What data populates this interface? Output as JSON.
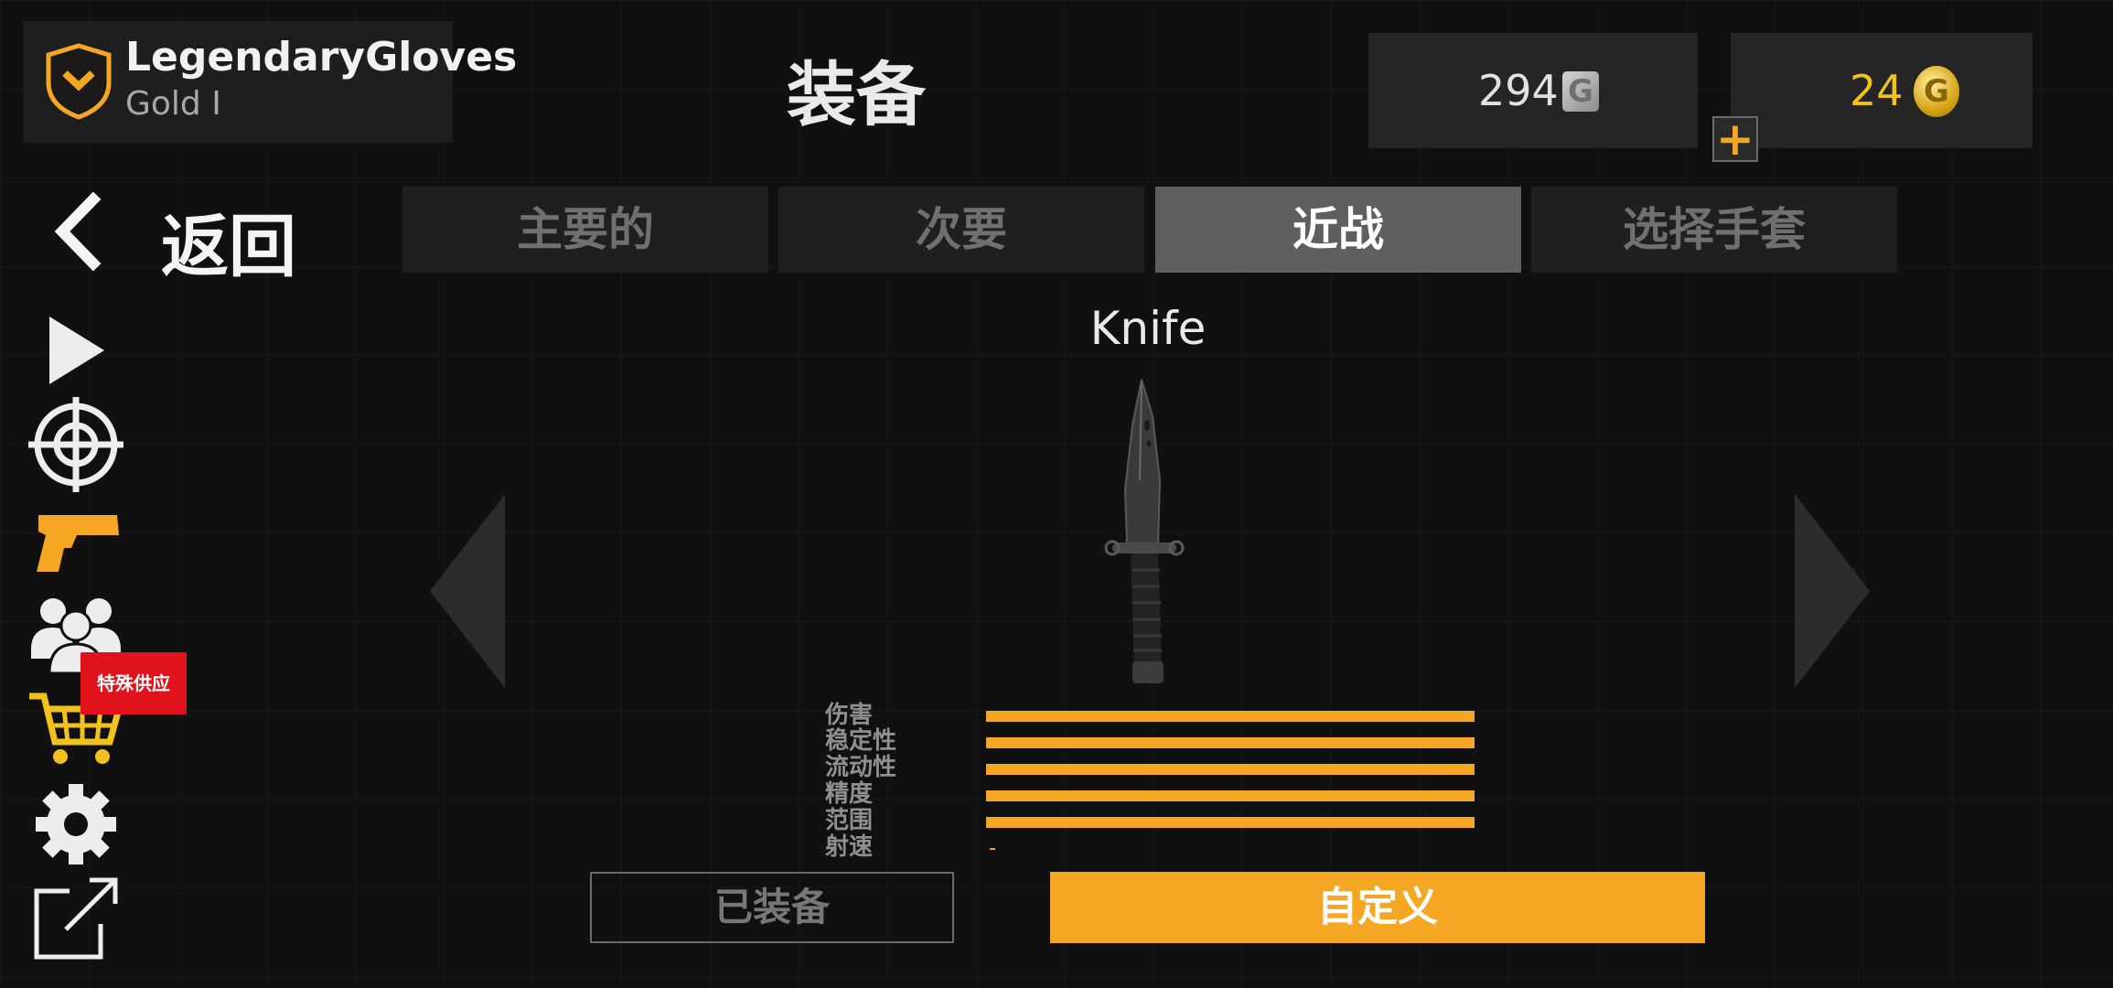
{
  "profile": {
    "name": "LegendaryGloves",
    "rank": "Gold I",
    "rank_icon": "shield-chevron-icon"
  },
  "header": {
    "title": "装备"
  },
  "currencies": {
    "silver": {
      "amount": "294",
      "icon": "silver-coin-icon",
      "glyph": "G"
    },
    "gold": {
      "amount": "24",
      "icon": "gold-coin-icon",
      "glyph": "G"
    },
    "add_glyph": "+"
  },
  "nav": {
    "back_label": "返回"
  },
  "tabs": [
    {
      "label": "主要的",
      "active": false
    },
    {
      "label": "次要",
      "active": false
    },
    {
      "label": "近战",
      "active": true
    },
    {
      "label": "选择手套",
      "active": false
    }
  ],
  "sidebar": {
    "items": [
      "play-icon",
      "crosshair-icon",
      "pistol-icon",
      "friends-icon",
      "cart-icon",
      "gear-icon",
      "external-link-icon"
    ],
    "special_offer_badge": "特殊供应"
  },
  "weapon": {
    "name": "Knife",
    "stats": [
      {
        "label": "伤害",
        "value": 1.0
      },
      {
        "label": "稳定性",
        "value": 1.0
      },
      {
        "label": "流动性",
        "value": 1.0
      },
      {
        "label": "精度",
        "value": 1.0
      },
      {
        "label": "范围",
        "value": 1.0
      },
      {
        "label": "射速",
        "value": 0.01
      }
    ]
  },
  "actions": {
    "equipped_label": "已装备",
    "customize_label": "自定义"
  },
  "colors": {
    "accent": "#f5a623",
    "gold_text": "#f1c21b",
    "badge_red": "#e0121c",
    "tab_active": "#5f5f5f"
  }
}
